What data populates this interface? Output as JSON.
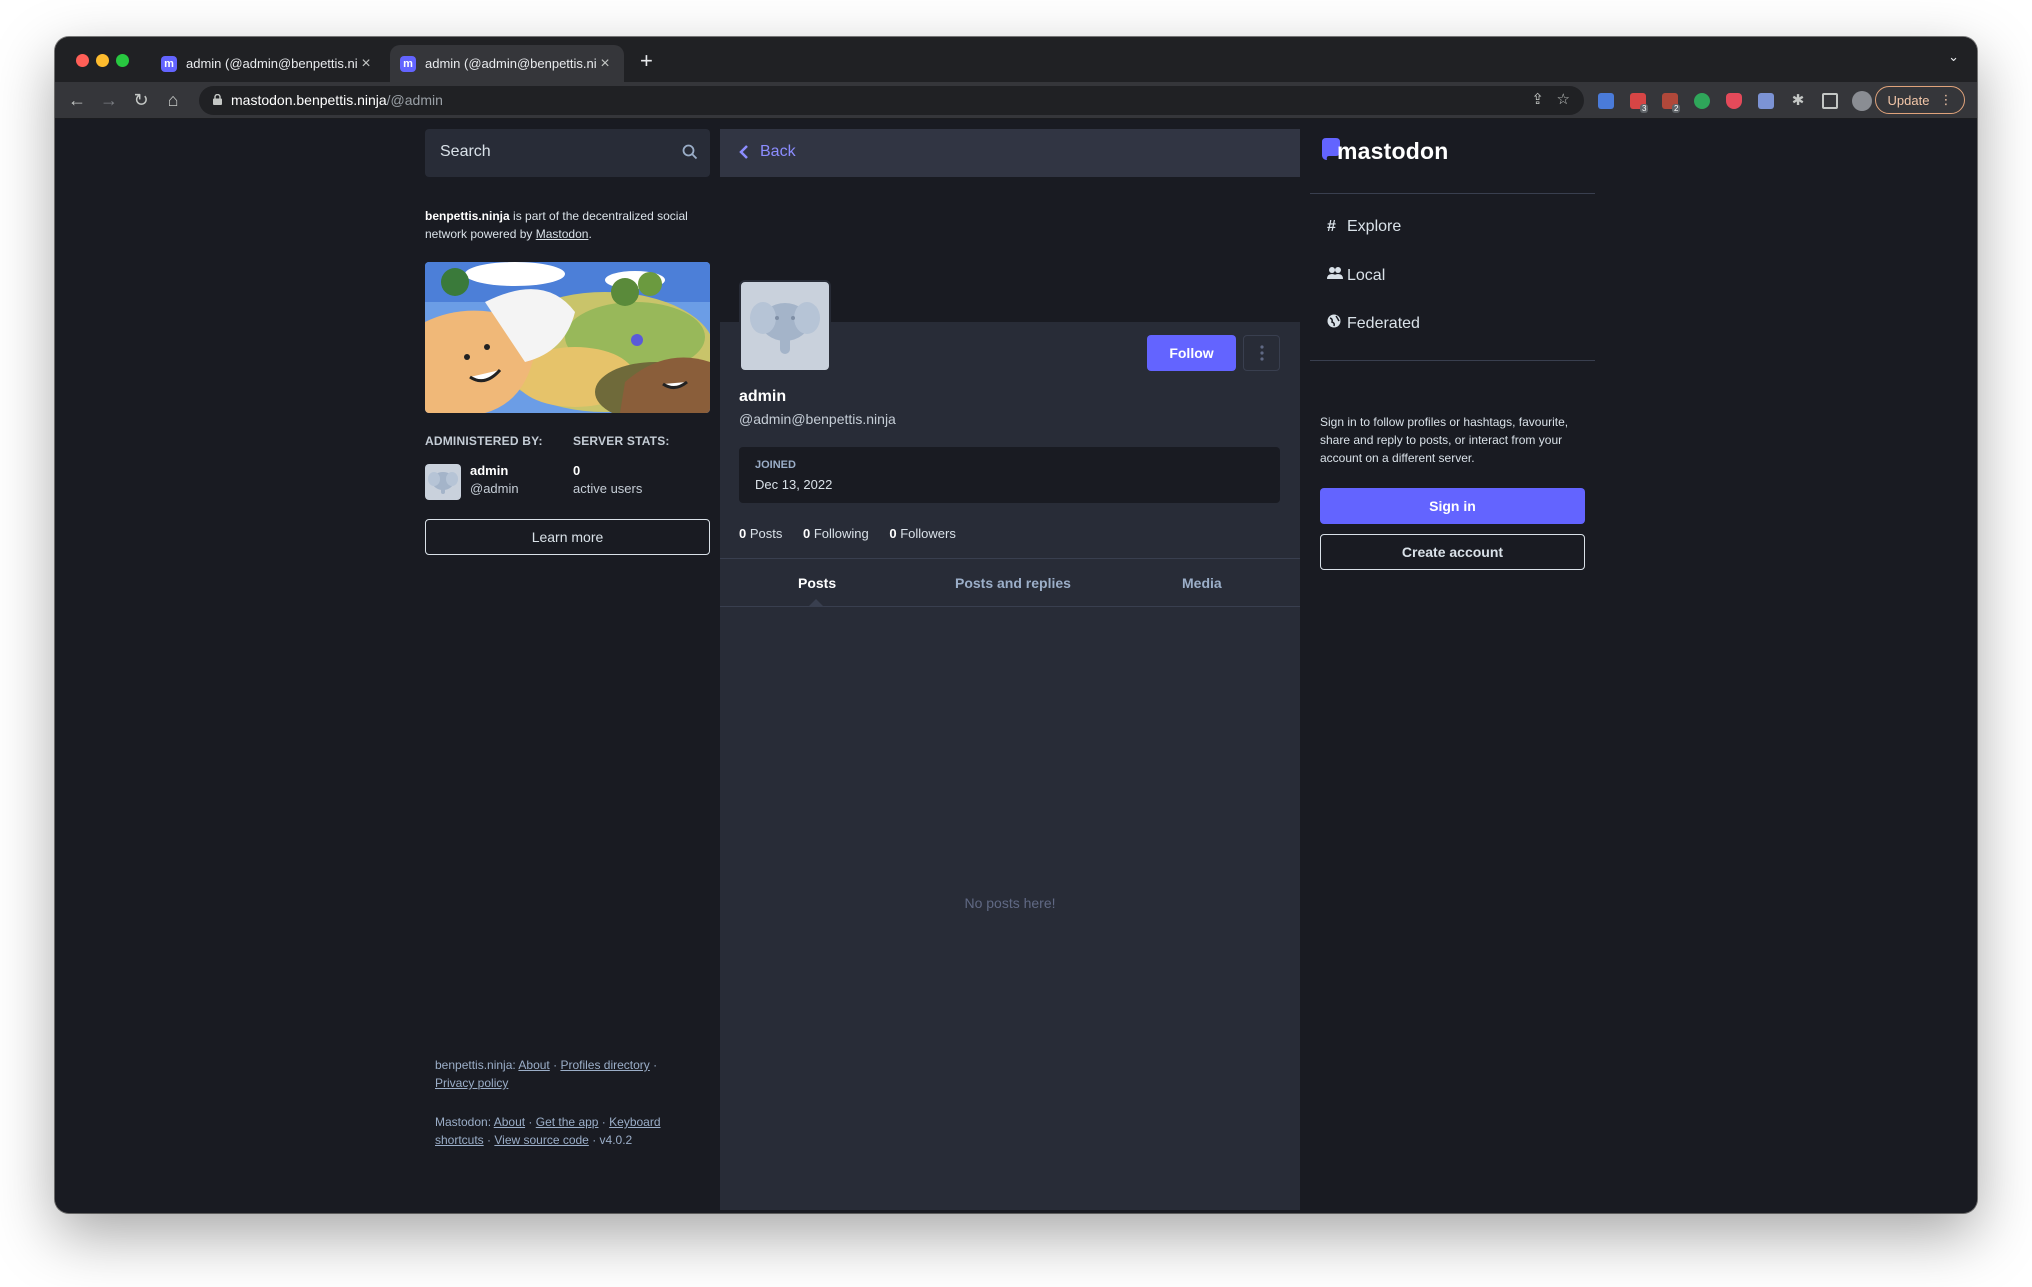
{
  "browser": {
    "tabs": [
      {
        "title": "admin (@admin@benpettis.ninja) - Mastodon"
      },
      {
        "title": "admin (@admin@benpettis.ninja) - Mastodon"
      }
    ],
    "url_host": "mastodon.benpettis.ninja",
    "url_path": "/@admin",
    "update_label": "Update",
    "badges": [
      "3",
      "2"
    ],
    "accent_color": "#6364ff"
  },
  "left": {
    "search_placeholder": "Search",
    "about_server": "benpettis.ninja",
    "about_text": " is part of the decentralized social network powered by ",
    "about_link": "Mastodon",
    "about_period": ".",
    "administered_by_label": "ADMINISTERED BY:",
    "server_stats_label": "SERVER STATS:",
    "admin_name": "admin",
    "admin_handle": "@admin",
    "active_users_count": "0",
    "active_users_label": "active users",
    "learn_more": "Learn more",
    "footer1": {
      "server": "benpettis.ninja",
      "links": [
        "About",
        "Profiles directory",
        "Privacy policy"
      ]
    },
    "footer2": {
      "app": "Mastodon",
      "links": [
        "About",
        "Get the app",
        "Keyboard shortcuts",
        "View source code"
      ],
      "version": "v4.0.2"
    }
  },
  "center": {
    "back_label": "Back",
    "follow_label": "Follow",
    "display_name": "admin",
    "acct": "@admin@benpettis.ninja",
    "joined_label": "Joined",
    "joined_date": "Dec 13, 2022",
    "counts": {
      "posts_num": "0",
      "posts_label": " Posts",
      "following_num": "0",
      "following_label": " Following",
      "followers_num": "0",
      "followers_label": " Followers"
    },
    "tabs": [
      "Posts",
      "Posts and replies",
      "Media"
    ],
    "empty_message": "No posts here!"
  },
  "right": {
    "logo_text": "mastodon",
    "nav": [
      "Explore",
      "Local",
      "Federated"
    ],
    "signin_text": "Sign in to follow profiles or hashtags, favourite, share and reply to posts, or interact from your account on a different server.",
    "signin_label": "Sign in",
    "create_label": "Create account"
  }
}
